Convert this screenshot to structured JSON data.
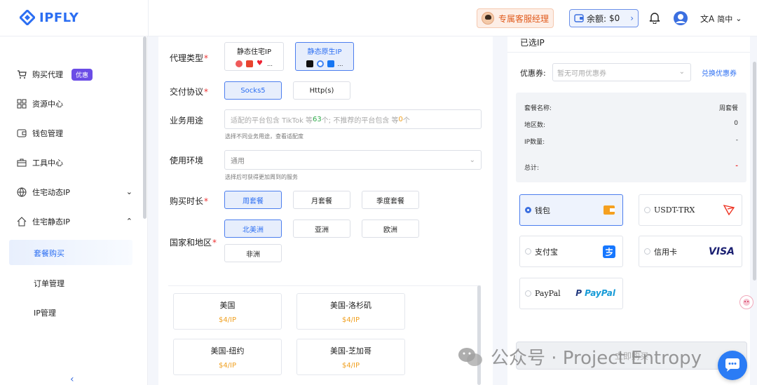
{
  "brand": {
    "name": "IPFLY",
    "color": "#2b6ef2"
  },
  "header": {
    "manager_label": "专属客服经理",
    "balance_label": "余额:",
    "balance_value": "$0",
    "lang_label": "简中"
  },
  "sidebar": {
    "items": [
      {
        "label": "购买代理",
        "icon": "cart-icon",
        "badge": "优惠"
      },
      {
        "label": "资源中心",
        "icon": "grid-icon"
      },
      {
        "label": "钱包管理",
        "icon": "wallet-icon"
      },
      {
        "label": "工具中心",
        "icon": "toolbox-icon"
      },
      {
        "label": "住宅动态IP",
        "icon": "globe-icon"
      },
      {
        "label": "住宅静态IP",
        "icon": "home-icon"
      }
    ],
    "sub_items": [
      "套餐购买",
      "订单管理",
      "IP管理"
    ]
  },
  "form": {
    "proxy_type_label": "代理类型",
    "proxy_types": [
      "静态住宅IP",
      "静态原生IP"
    ],
    "protocol_label": "交付协议",
    "protocols": [
      "Socks5",
      "Http(s)"
    ],
    "usage_label": "业务用途",
    "usage_placeholder_a": "适配的平台包含 TikTok 等 ",
    "usage_count_a": "63",
    "usage_placeholder_b": "个; 不推荐的平台包含 等 ",
    "usage_count_b": "0",
    "usage_placeholder_c": "个",
    "usage_hint": "选择不同业务用途，查看适配度",
    "env_label": "使用环境",
    "env_value": "通用",
    "env_hint": "选择后可获得更加周到的服务",
    "duration_label": "购买时长",
    "durations": [
      "周套餐",
      "月套餐",
      "季度套餐"
    ],
    "region_label": "国家和地区",
    "regions": [
      "北美洲",
      "亚洲",
      "欧洲",
      "非洲"
    ]
  },
  "locations": [
    {
      "name": "美国",
      "price": "$4/IP"
    },
    {
      "name": "美国-洛杉矶",
      "price": "$4/IP"
    },
    {
      "name": "美国-纽约",
      "price": "$4/IP"
    },
    {
      "name": "美国-芝加哥",
      "price": "$4/IP"
    }
  ],
  "order": {
    "title": "已选IP",
    "coupon_label": "优惠券:",
    "coupon_placeholder": "暂无可用优惠券",
    "redeem_label": "兑换优惠券",
    "rows": [
      {
        "k": "套餐名称:",
        "v": "周套餐"
      },
      {
        "k": "地区数:",
        "v": "0"
      },
      {
        "k": "IP数量:",
        "v": "-"
      }
    ],
    "total_label": "总计:",
    "total_value": "-",
    "payments": [
      "钱包",
      "USDT-TRX",
      "支付宝",
      "信用卡",
      "PayPal"
    ],
    "paypal_logo": "PayPal",
    "visa_logo": "VISA",
    "buy_label": "立即购买"
  },
  "watermark": "公众号 · Project Entropy"
}
